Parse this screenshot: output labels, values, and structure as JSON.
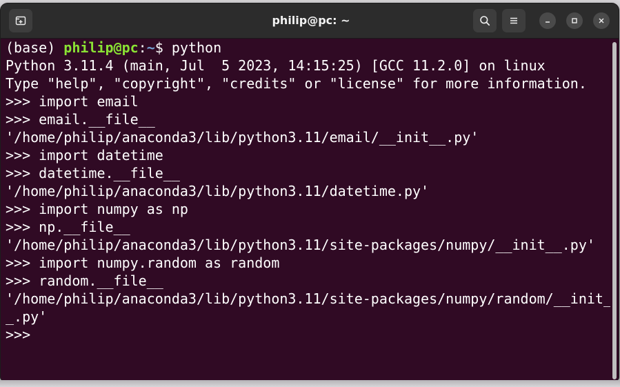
{
  "window": {
    "title": "philip@pc: ~"
  },
  "titlebar": {
    "new_tab_icon": "new-tab-icon",
    "search_icon": "search-icon",
    "menu_icon": "hamburger-menu-icon",
    "minimize_icon": "minimize-icon",
    "maximize_icon": "maximize-icon",
    "close_icon": "close-icon"
  },
  "terminal": {
    "prompt": {
      "env": "(base) ",
      "user_host": "philip@pc",
      "colon": ":",
      "path": "~",
      "dollar": "$ ",
      "command": "python"
    },
    "lines": [
      "Python 3.11.4 (main, Jul  5 2023, 14:15:25) [GCC 11.2.0] on linux",
      "Type \"help\", \"copyright\", \"credits\" or \"license\" for more information.",
      ">>> import email",
      ">>> email.__file__",
      "'/home/philip/anaconda3/lib/python3.11/email/__init__.py'",
      ">>> import datetime",
      ">>> datetime.__file__",
      "'/home/philip/anaconda3/lib/python3.11/datetime.py'",
      ">>> import numpy as np",
      ">>> np.__file__",
      "'/home/philip/anaconda3/lib/python3.11/site-packages/numpy/__init__.py'",
      ">>> import numpy.random as random",
      ">>> random.__file__",
      "'/home/philip/anaconda3/lib/python3.11/site-packages/numpy/random/__init_",
      "_.py'",
      ">>> "
    ]
  },
  "colors": {
    "terminal_bg": "#300a24",
    "titlebar_bg": "#2c2c2c",
    "prompt_user": "#8ae234",
    "prompt_path": "#729fcf",
    "text": "#ffffff"
  }
}
